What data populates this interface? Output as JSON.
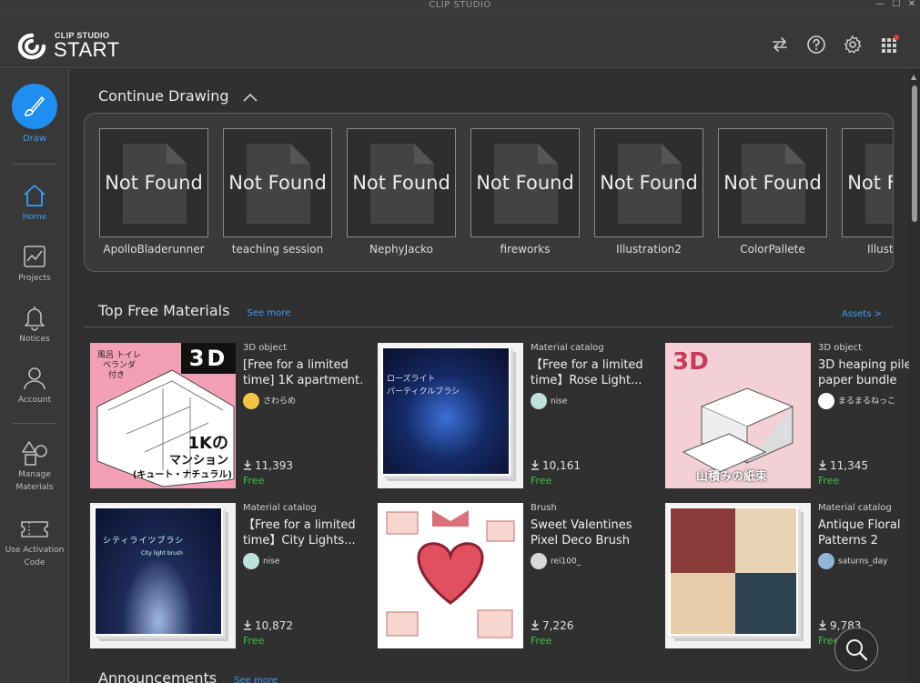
{
  "window": {
    "title": "CLIP STUDIO",
    "minimize": "—",
    "maximize": "☐",
    "close": "✕"
  },
  "logo": {
    "small": "CLIP STUDIO",
    "big": "START"
  },
  "header_icons": [
    "sync-icon",
    "help-icon",
    "gear-icon",
    "apps-grid-icon"
  ],
  "colors": {
    "accent": "#1f8ef1",
    "link": "#3c9cf5",
    "free": "#3fbf4a",
    "notification": "#e53935"
  },
  "sidebar": {
    "draw": "Draw",
    "items": [
      {
        "label": "Home",
        "icon": "home-icon",
        "active": true
      },
      {
        "label": "Projects",
        "icon": "chart-icon"
      },
      {
        "label": "Notices",
        "icon": "bell-icon"
      },
      {
        "label": "Account",
        "icon": "person-icon"
      },
      {
        "label": "Manage",
        "label2": "Materials",
        "icon": "shapes-icon"
      },
      {
        "label": "Use Activation",
        "label2": "Code",
        "icon": "ticket-icon"
      }
    ]
  },
  "continue": {
    "title": "Continue Drawing",
    "not_found": "Not Found",
    "files": [
      "ApolloBladerunner",
      "teaching session",
      "NephyJacko",
      "fireworks",
      "Illustration2",
      "ColorPallete",
      "Illustration"
    ]
  },
  "top_materials": {
    "title": "Top Free Materials",
    "see_more": "See more",
    "assets": "Assets >",
    "cards": [
      {
        "category": "3D object",
        "title1": "[Free for a limited",
        "title2": "time] 1K apartment...",
        "author": "さわらめ",
        "downloads": "11,393",
        "price": "Free",
        "badge": "3D",
        "img_text1": "1Kの",
        "img_text2": "マンション",
        "img_text3": "(キュート・ナチュラル)",
        "img_note1": "風呂 トイレ",
        "img_note2": "ベランダ",
        "img_note3": "付き"
      },
      {
        "category": "Material catalog",
        "title1": "【Free for a limited",
        "title2": "time】Rose Light...",
        "author": "nise",
        "downloads": "10,161",
        "price": "Free",
        "img_text1": "ローズライト",
        "img_text2": "パーティクルブラシ"
      },
      {
        "category": "3D object",
        "title1": "3D heaping pile of",
        "title2": "paper bundle",
        "author": "まるまるねっこ",
        "downloads": "11,345",
        "price": "Free",
        "badge": "3D",
        "img_text1": "山積みの紙束"
      },
      {
        "category": "Material catalog",
        "title1": "【Free for a limited",
        "title2": "time】City Lights...",
        "author": "nise",
        "downloads": "10,872",
        "price": "Free",
        "img_text1": "シティライツブラシ",
        "img_text2": "City light brush"
      },
      {
        "category": "Brush",
        "title1": "Sweet Valentines",
        "title2": "Pixel Deco Brush",
        "author": "rei100_",
        "downloads": "7,226",
        "price": "Free"
      },
      {
        "category": "Material catalog",
        "title1": "Antique Floral",
        "title2": "Patterns 2",
        "author": "saturns_day",
        "downloads": "9,783",
        "price": "Free"
      }
    ]
  },
  "announcements": {
    "title": "Announcements",
    "see_more": "See more"
  }
}
